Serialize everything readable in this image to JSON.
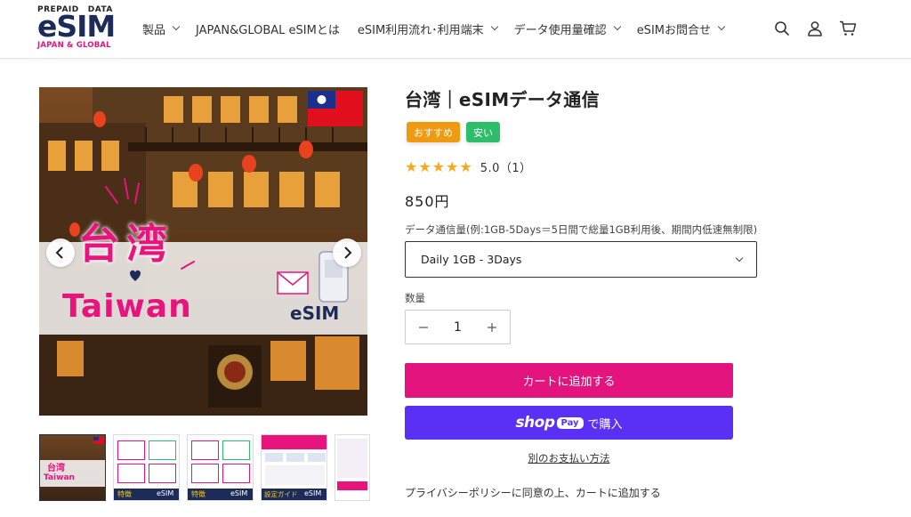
{
  "brand": {
    "top_left": "PREPAID",
    "top_right": "DATA",
    "main": "eSIM",
    "sub": "JAPAN & GLOBAL"
  },
  "nav": {
    "items": [
      {
        "label": "製品",
        "has_menu": true
      },
      {
        "label": "JAPAN&GLOBAL eSIMとは",
        "has_menu": false
      },
      {
        "label": "eSIM利用流れ･利用端末",
        "has_menu": true
      },
      {
        "label": "データ使用量確認",
        "has_menu": true
      },
      {
        "label": "eSIMお問合せ",
        "has_menu": true
      }
    ]
  },
  "header_icons": [
    "search-icon",
    "account-icon",
    "cart-icon"
  ],
  "gallery": {
    "main_text_cn": "台湾",
    "main_text_en": "Taiwan",
    "main_text_esim": "eSIM",
    "thumb_texts": [
      {
        "a": "台湾",
        "b": "Taiwan"
      },
      {
        "a": "特徴",
        "b": "eSIM"
      },
      {
        "a": "特徴",
        "b": "eSIM"
      },
      {
        "a": "設定ガイド",
        "b": "eSIM"
      },
      {
        "a": "",
        "b": ""
      }
    ]
  },
  "product": {
    "title": "台湾｜eSIMデータ通信",
    "badges": [
      "おすすめ",
      "安い"
    ],
    "rating_value": 5.0,
    "rating_text": "5.0（1）",
    "price": "850円",
    "variant_label": "データ通信量(例:1GB-5Days＝5日間で総量1GB利用後、期間内低速無制限)",
    "variant_selected": "Daily 1GB - 3Days",
    "quantity_label": "数量",
    "quantity": "1",
    "add_to_cart": "カートに追加する",
    "shop_pay_word": "shop",
    "shop_pay_pill": "Pay",
    "shop_pay_buy": "で購入",
    "more_payment": "別のお支払い方法",
    "privacy_note": "プライバシーポリシーに同意の上、カートに追加する"
  },
  "colors": {
    "brand_navy": "#1d2b58",
    "brand_pink": "#e4167e",
    "cart_button": "#e4147e",
    "shop_pay": "#5a31f4",
    "badge_orange": "#f09a12",
    "badge_green": "#2ebd6a",
    "star": "#f7a81e"
  }
}
